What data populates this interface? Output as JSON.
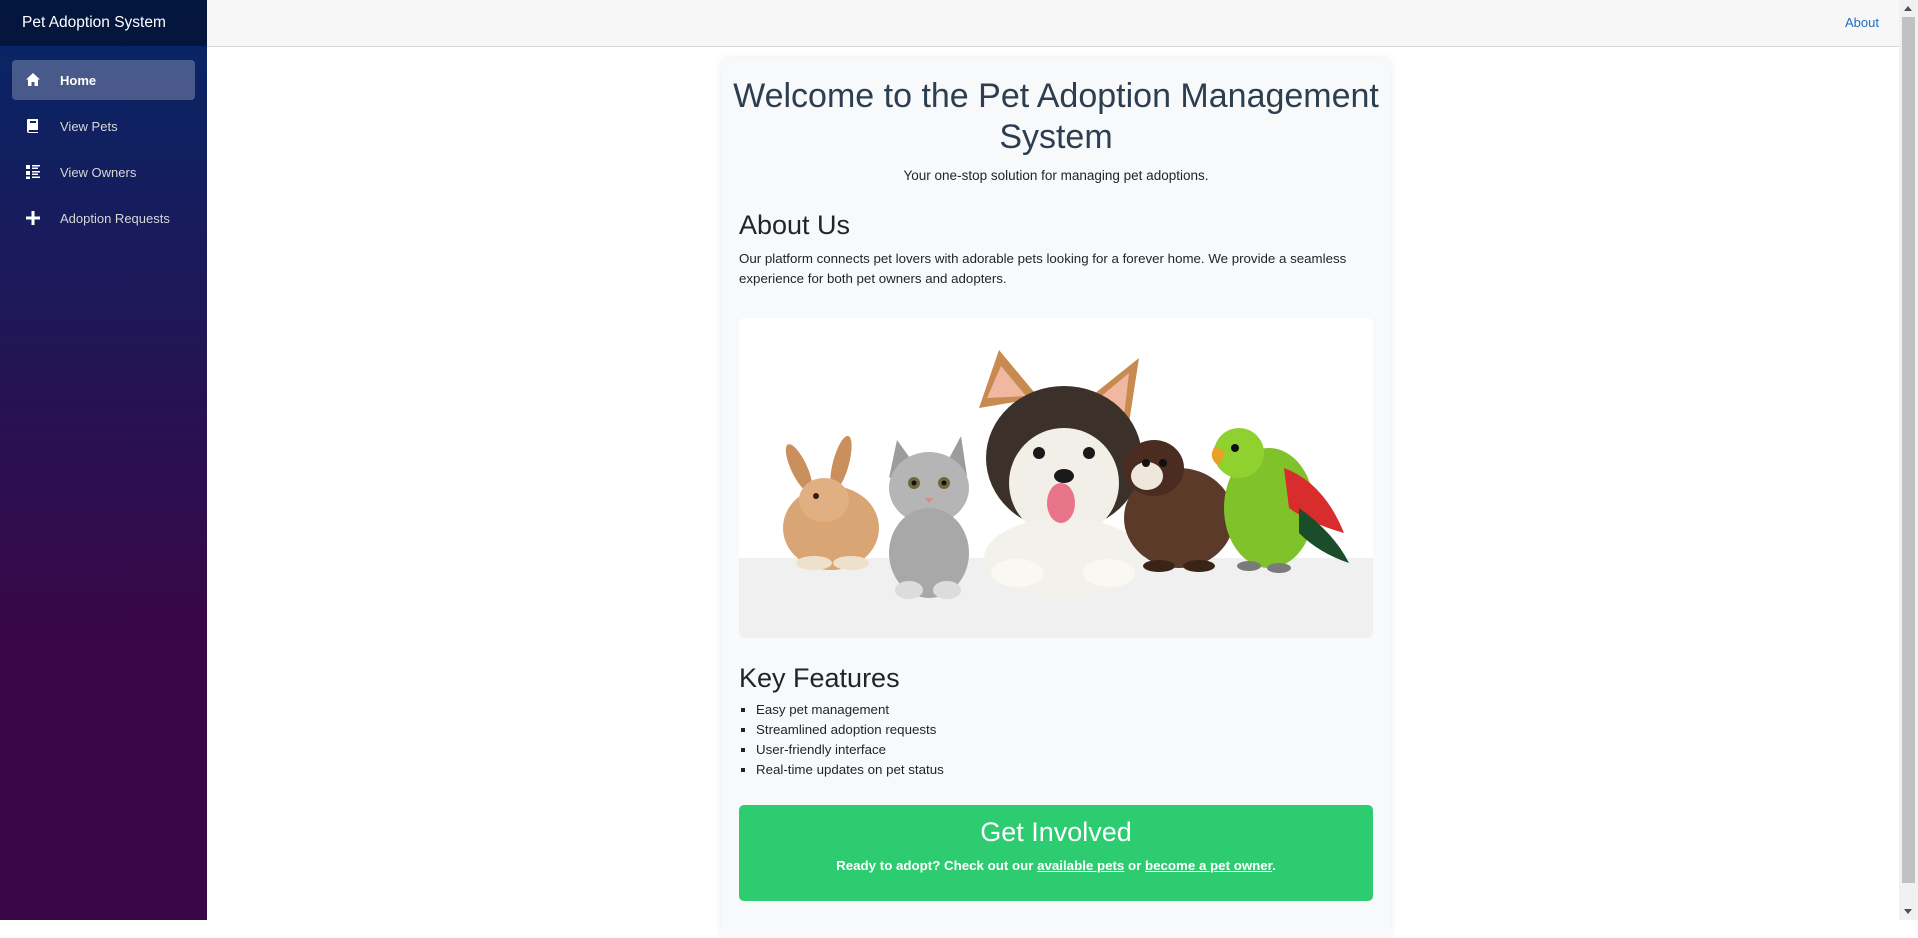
{
  "app": {
    "brand": "Pet Adoption System"
  },
  "sidebar": {
    "items": [
      {
        "label": "Home",
        "icon": "home-icon",
        "active": true
      },
      {
        "label": "View Pets",
        "icon": "book-icon",
        "active": false
      },
      {
        "label": "View Owners",
        "icon": "list-icon",
        "active": false
      },
      {
        "label": "Adoption Requests",
        "icon": "plus-icon",
        "active": false
      }
    ]
  },
  "topbar": {
    "about_label": "About"
  },
  "main": {
    "title": "Welcome to the Pet Adoption Management System",
    "subtitle": "Your one-stop solution for managing pet adoptions.",
    "about": {
      "heading": "About Us",
      "text": "Our platform connects pet lovers with adorable pets looking for a forever home. We provide a seamless experience for both pet owners and adopters."
    },
    "image": {
      "subject": "rabbit, kitten, corgi puppy, ferret and parrot"
    },
    "features": {
      "heading": "Key Features",
      "items": [
        "Easy pet management",
        "Streamlined adoption requests",
        "User-friendly interface",
        "Real-time updates on pet status"
      ]
    },
    "cta": {
      "heading": "Get Involved",
      "text_before": "Ready to adopt? Check out our ",
      "link1": "available pets",
      "text_middle": " or ",
      "link2": "become a pet owner",
      "text_after": "."
    }
  },
  "colors": {
    "sidebar_top": "#052767",
    "sidebar_bottom": "#3a0647",
    "accent_link": "#1b6ec2",
    "cta_green": "#2ecc71",
    "title_color": "#2c3e50"
  }
}
